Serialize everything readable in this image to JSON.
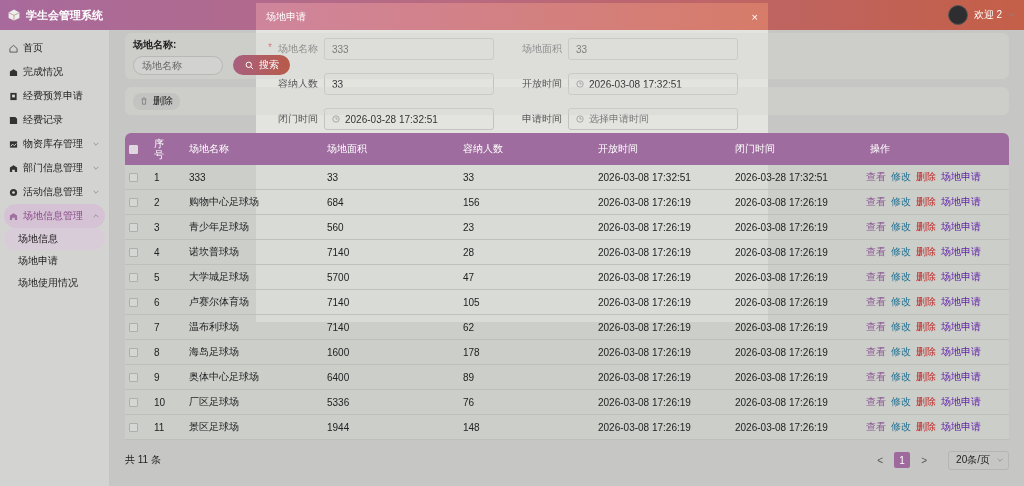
{
  "header": {
    "title": "学生会管理系统",
    "greeting": "欢迎 2"
  },
  "sidebar": {
    "items": [
      {
        "label": "首页",
        "selected": false
      },
      {
        "label": "完成情况",
        "selected": false
      },
      {
        "label": "经费预算申请",
        "selected": false
      },
      {
        "label": "经费记录",
        "selected": false
      },
      {
        "label": "物资库存管理",
        "expanded": false,
        "selected": false
      },
      {
        "label": "部门信息管理",
        "expanded": false,
        "selected": false
      },
      {
        "label": "活动信息管理",
        "expanded": false,
        "selected": false
      },
      {
        "label": "场地信息管理",
        "expanded": true,
        "selected": true,
        "children": [
          {
            "label": "场地信息",
            "selected": true
          },
          {
            "label": "场地申请",
            "selected": false
          },
          {
            "label": "场地使用情况",
            "selected": false
          }
        ]
      }
    ]
  },
  "search": {
    "label": "场地名称:",
    "placeholder": "场地名称",
    "button": "搜索"
  },
  "toolbar": {
    "delete_button": "删除"
  },
  "table": {
    "columns": [
      "序号",
      "场地名称",
      "场地面积",
      "容纳人数",
      "开放时间",
      "闭门时间",
      "操作"
    ],
    "all_checked": false,
    "rows": [
      {
        "checked": false,
        "cells": [
          "1",
          "333",
          "33",
          "33",
          "2026-03-08 17:32:51",
          "2026-03-28 17:32:51"
        ],
        "actions": [
          {
            "label": "查看",
            "kind": "view"
          },
          {
            "label": "修改",
            "kind": "edit"
          },
          {
            "label": "删除",
            "kind": "delete"
          },
          {
            "label": "场地申请",
            "kind": "apply"
          }
        ]
      },
      {
        "checked": false,
        "cells": [
          "2",
          "购物中心足球场",
          "684",
          "156",
          "2026-03-08 17:26:19",
          "2026-03-08 17:26:19"
        ],
        "actions": [
          {
            "label": "查看",
            "kind": "view"
          },
          {
            "label": "修改",
            "kind": "edit"
          },
          {
            "label": "删除",
            "kind": "delete"
          },
          {
            "label": "场地申请",
            "kind": "apply"
          }
        ]
      },
      {
        "checked": false,
        "cells": [
          "3",
          "青少年足球场",
          "560",
          "23",
          "2026-03-08 17:26:19",
          "2026-03-08 17:26:19"
        ],
        "actions": [
          {
            "label": "查看",
            "kind": "view"
          },
          {
            "label": "修改",
            "kind": "edit"
          },
          {
            "label": "删除",
            "kind": "delete"
          },
          {
            "label": "场地申请",
            "kind": "apply"
          }
        ]
      },
      {
        "checked": false,
        "cells": [
          "4",
          "诺坎普球场",
          "7140",
          "28",
          "2026-03-08 17:26:19",
          "2026-03-08 17:26:19"
        ],
        "actions": [
          {
            "label": "查看",
            "kind": "view"
          },
          {
            "label": "修改",
            "kind": "edit"
          },
          {
            "label": "删除",
            "kind": "delete"
          },
          {
            "label": "场地申请",
            "kind": "apply"
          }
        ]
      },
      {
        "checked": false,
        "cells": [
          "5",
          "大学城足球场",
          "5700",
          "47",
          "2026-03-08 17:26:19",
          "2026-03-08 17:26:19"
        ],
        "actions": [
          {
            "label": "查看",
            "kind": "view"
          },
          {
            "label": "修改",
            "kind": "edit"
          },
          {
            "label": "删除",
            "kind": "delete"
          },
          {
            "label": "场地申请",
            "kind": "apply"
          }
        ]
      },
      {
        "checked": false,
        "cells": [
          "6",
          "卢赛尔体育场",
          "7140",
          "105",
          "2026-03-08 17:26:19",
          "2026-03-08 17:26:19"
        ],
        "actions": [
          {
            "label": "查看",
            "kind": "view"
          },
          {
            "label": "修改",
            "kind": "edit"
          },
          {
            "label": "删除",
            "kind": "delete"
          },
          {
            "label": "场地申请",
            "kind": "apply"
          }
        ]
      },
      {
        "checked": false,
        "cells": [
          "7",
          "温布利球场",
          "7140",
          "62",
          "2026-03-08 17:26:19",
          "2026-03-08 17:26:19"
        ],
        "actions": [
          {
            "label": "查看",
            "kind": "view"
          },
          {
            "label": "修改",
            "kind": "edit"
          },
          {
            "label": "删除",
            "kind": "delete"
          },
          {
            "label": "场地申请",
            "kind": "apply"
          }
        ]
      },
      {
        "checked": false,
        "cells": [
          "8",
          "海岛足球场",
          "1600",
          "178",
          "2026-03-08 17:26:19",
          "2026-03-08 17:26:19"
        ],
        "actions": [
          {
            "label": "查看",
            "kind": "view"
          },
          {
            "label": "修改",
            "kind": "edit"
          },
          {
            "label": "删除",
            "kind": "delete"
          },
          {
            "label": "场地申请",
            "kind": "apply"
          }
        ]
      },
      {
        "checked": false,
        "cells": [
          "9",
          "奥体中心足球场",
          "6400",
          "89",
          "2026-03-08 17:26:19",
          "2026-03-08 17:26:19"
        ],
        "actions": [
          {
            "label": "查看",
            "kind": "view"
          },
          {
            "label": "修改",
            "kind": "edit"
          },
          {
            "label": "删除",
            "kind": "delete"
          },
          {
            "label": "场地申请",
            "kind": "apply"
          }
        ]
      },
      {
        "checked": false,
        "cells": [
          "10",
          "厂区足球场",
          "5336",
          "76",
          "2026-03-08 17:26:19",
          "2026-03-08 17:26:19"
        ],
        "actions": [
          {
            "label": "查看",
            "kind": "view"
          },
          {
            "label": "修改",
            "kind": "edit"
          },
          {
            "label": "删除",
            "kind": "delete"
          },
          {
            "label": "场地申请",
            "kind": "apply"
          }
        ]
      },
      {
        "checked": false,
        "cells": [
          "11",
          "景区足球场",
          "1944",
          "148",
          "2026-03-08 17:26:19",
          "2026-03-08 17:26:19"
        ],
        "actions": [
          {
            "label": "查看",
            "kind": "view"
          },
          {
            "label": "修改",
            "kind": "edit"
          },
          {
            "label": "删除",
            "kind": "delete"
          },
          {
            "label": "场地申请",
            "kind": "apply"
          }
        ]
      }
    ]
  },
  "pagination": {
    "total": "共 11 条",
    "prev": "<",
    "next": ">",
    "pages": [
      {
        "label": "1",
        "selected": true
      }
    ],
    "page_size": "20条/页"
  },
  "modal": {
    "title": "场地申请",
    "close": "×",
    "fields": [
      {
        "label": "场地名称",
        "required_mark": "*",
        "kind": "text",
        "value": "333"
      },
      {
        "label": "场地面积",
        "kind": "text",
        "value": "33"
      },
      {
        "label": "容纳人数",
        "kind": "text",
        "value": "33"
      },
      {
        "label": "开放时间",
        "kind": "date",
        "value": "2026-03-08 17:32:51"
      },
      {
        "label": "闭门时间",
        "kind": "date",
        "value": "2026-03-28 17:32:51"
      },
      {
        "label": "申请时间",
        "kind": "date",
        "placeholder": "选择申请时间"
      }
    ]
  }
}
